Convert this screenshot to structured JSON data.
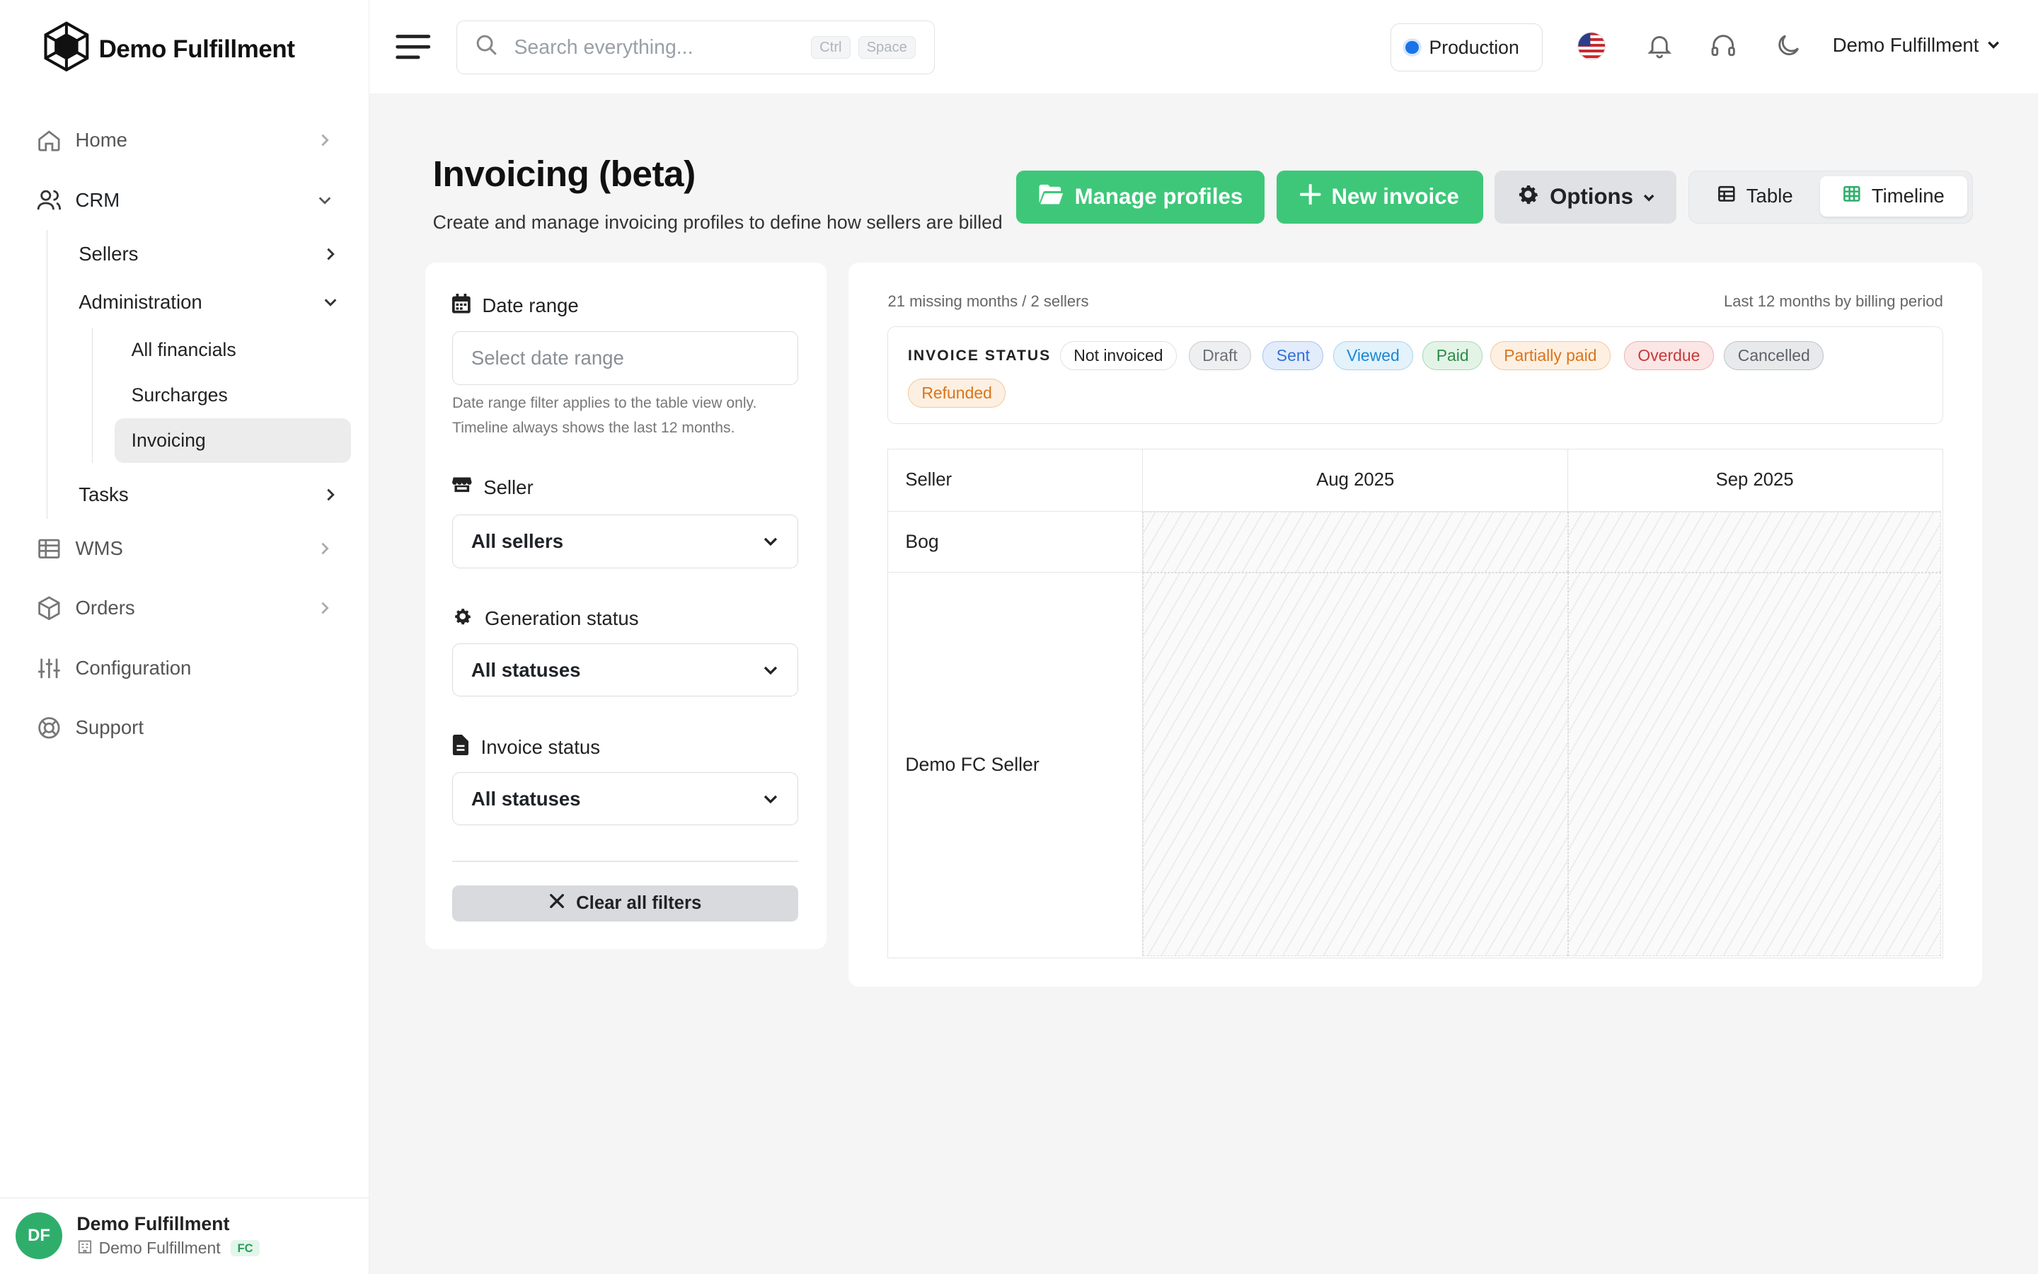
{
  "brand": {
    "name": "Demo Fulfillment"
  },
  "sidebar": {
    "items": [
      {
        "label": "Home",
        "icon": "home-icon"
      },
      {
        "label": "CRM",
        "icon": "users-icon"
      },
      {
        "label": "WMS",
        "icon": "table-icon"
      },
      {
        "label": "Orders",
        "icon": "box-icon"
      },
      {
        "label": "Configuration",
        "icon": "sliders-icon"
      },
      {
        "label": "Support",
        "icon": "lifebuoy-icon"
      }
    ],
    "crm_children": {
      "sellers": "Sellers",
      "administration": "Administration",
      "tasks": "Tasks"
    },
    "admin_children": [
      "All financials",
      "Surcharges",
      "Invoicing"
    ],
    "footer": {
      "initials": "DF",
      "name": "Demo Fulfillment",
      "org": "Demo Fulfillment",
      "badge": "FC"
    }
  },
  "topbar": {
    "search_placeholder": "Search everything...",
    "shortcut_keys": [
      "Ctrl",
      "Space"
    ],
    "environment": "Production",
    "user_menu": "Demo Fulfillment"
  },
  "page": {
    "title": "Invoicing (beta)",
    "subtitle": "Create and manage invoicing profiles to define how sellers are billed",
    "buttons": {
      "manage_profiles": "Manage profiles",
      "new_invoice": "New invoice",
      "options": "Options"
    },
    "views": {
      "table": "Table",
      "timeline": "Timeline",
      "active": "Timeline"
    }
  },
  "filters": {
    "date_range": {
      "label": "Date range",
      "placeholder": "Select date range",
      "help": "Date range filter applies to the table view only. Timeline always shows the last 12 months."
    },
    "seller": {
      "label": "Seller",
      "value": "All sellers"
    },
    "generation_status": {
      "label": "Generation status",
      "value": "All statuses"
    },
    "invoice_status": {
      "label": "Invoice status",
      "value": "All statuses"
    },
    "clear": "Clear all filters"
  },
  "timeline": {
    "summary": "21 missing months / 2 sellers",
    "period_note": "Last 12 months by billing period",
    "legend_title": "INVOICE STATUS",
    "statuses": [
      {
        "label": "Not invoiced",
        "color": "#222222",
        "bg": "#ffffff",
        "border": "#dfe1e4"
      },
      {
        "label": "Draft",
        "color": "#6b6f75",
        "bg": "#eeeff1",
        "border": "#c9ccd0"
      },
      {
        "label": "Sent",
        "color": "#2f6fd6",
        "bg": "#e3ecfb",
        "border": "#a9c3ef"
      },
      {
        "label": "Viewed",
        "color": "#1a88d6",
        "bg": "#e3f2fb",
        "border": "#a9d3ee"
      },
      {
        "label": "Paid",
        "color": "#2d8a4a",
        "bg": "#e3f4e7",
        "border": "#a6d8b3"
      },
      {
        "label": "Partially paid",
        "color": "#d9741d",
        "bg": "#fdf0e2",
        "border": "#f1c89f"
      },
      {
        "label": "Overdue",
        "color": "#c53a3a",
        "bg": "#fbe5e5",
        "border": "#eeb1b1"
      },
      {
        "label": "Cancelled",
        "color": "#5e6268",
        "bg": "#e8e9eb",
        "border": "#bfc2c6"
      },
      {
        "label": "Refunded",
        "color": "#d9741d",
        "bg": "#fdf0e2",
        "border": "#f1c89f"
      }
    ],
    "columns": [
      "Seller",
      "Aug 2025",
      "Sep 2025"
    ],
    "rows": [
      "Bog",
      "Demo FC Seller"
    ]
  }
}
